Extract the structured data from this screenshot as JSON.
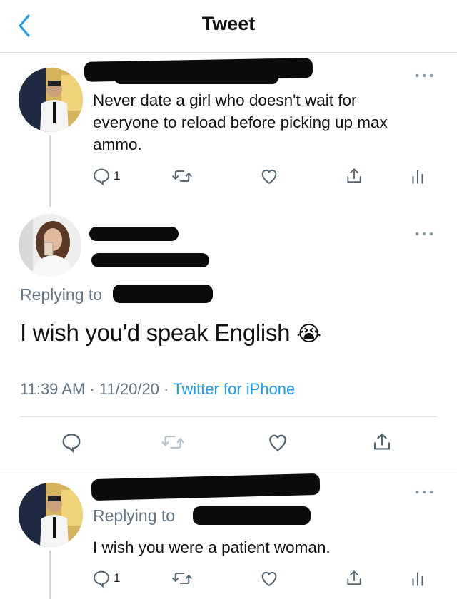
{
  "header": {
    "title": "Tweet"
  },
  "tweet1": {
    "text_lines": [
      "Never date a girl who doesn't wait for",
      "everyone to reload before picking up max",
      "ammo."
    ],
    "reply_count": "1"
  },
  "main_tweet": {
    "replying_label": "Replying to",
    "text": "I wish you'd speak English",
    "emoji": "😭",
    "time": "11:39 AM",
    "date": "11/20/20",
    "source": "Twitter for iPhone",
    "sep": "·"
  },
  "tweet3": {
    "replying_label": "Replying to",
    "text": "I wish you were a patient woman.",
    "reply_count": "1"
  },
  "colors": {
    "link": "#1d9bf0",
    "muted": "#657786",
    "icon": "#536471"
  },
  "icons": [
    "chevron-left-icon",
    "more-icon",
    "reply-icon",
    "retweet-icon",
    "like-icon",
    "share-icon",
    "analytics-icon"
  ]
}
